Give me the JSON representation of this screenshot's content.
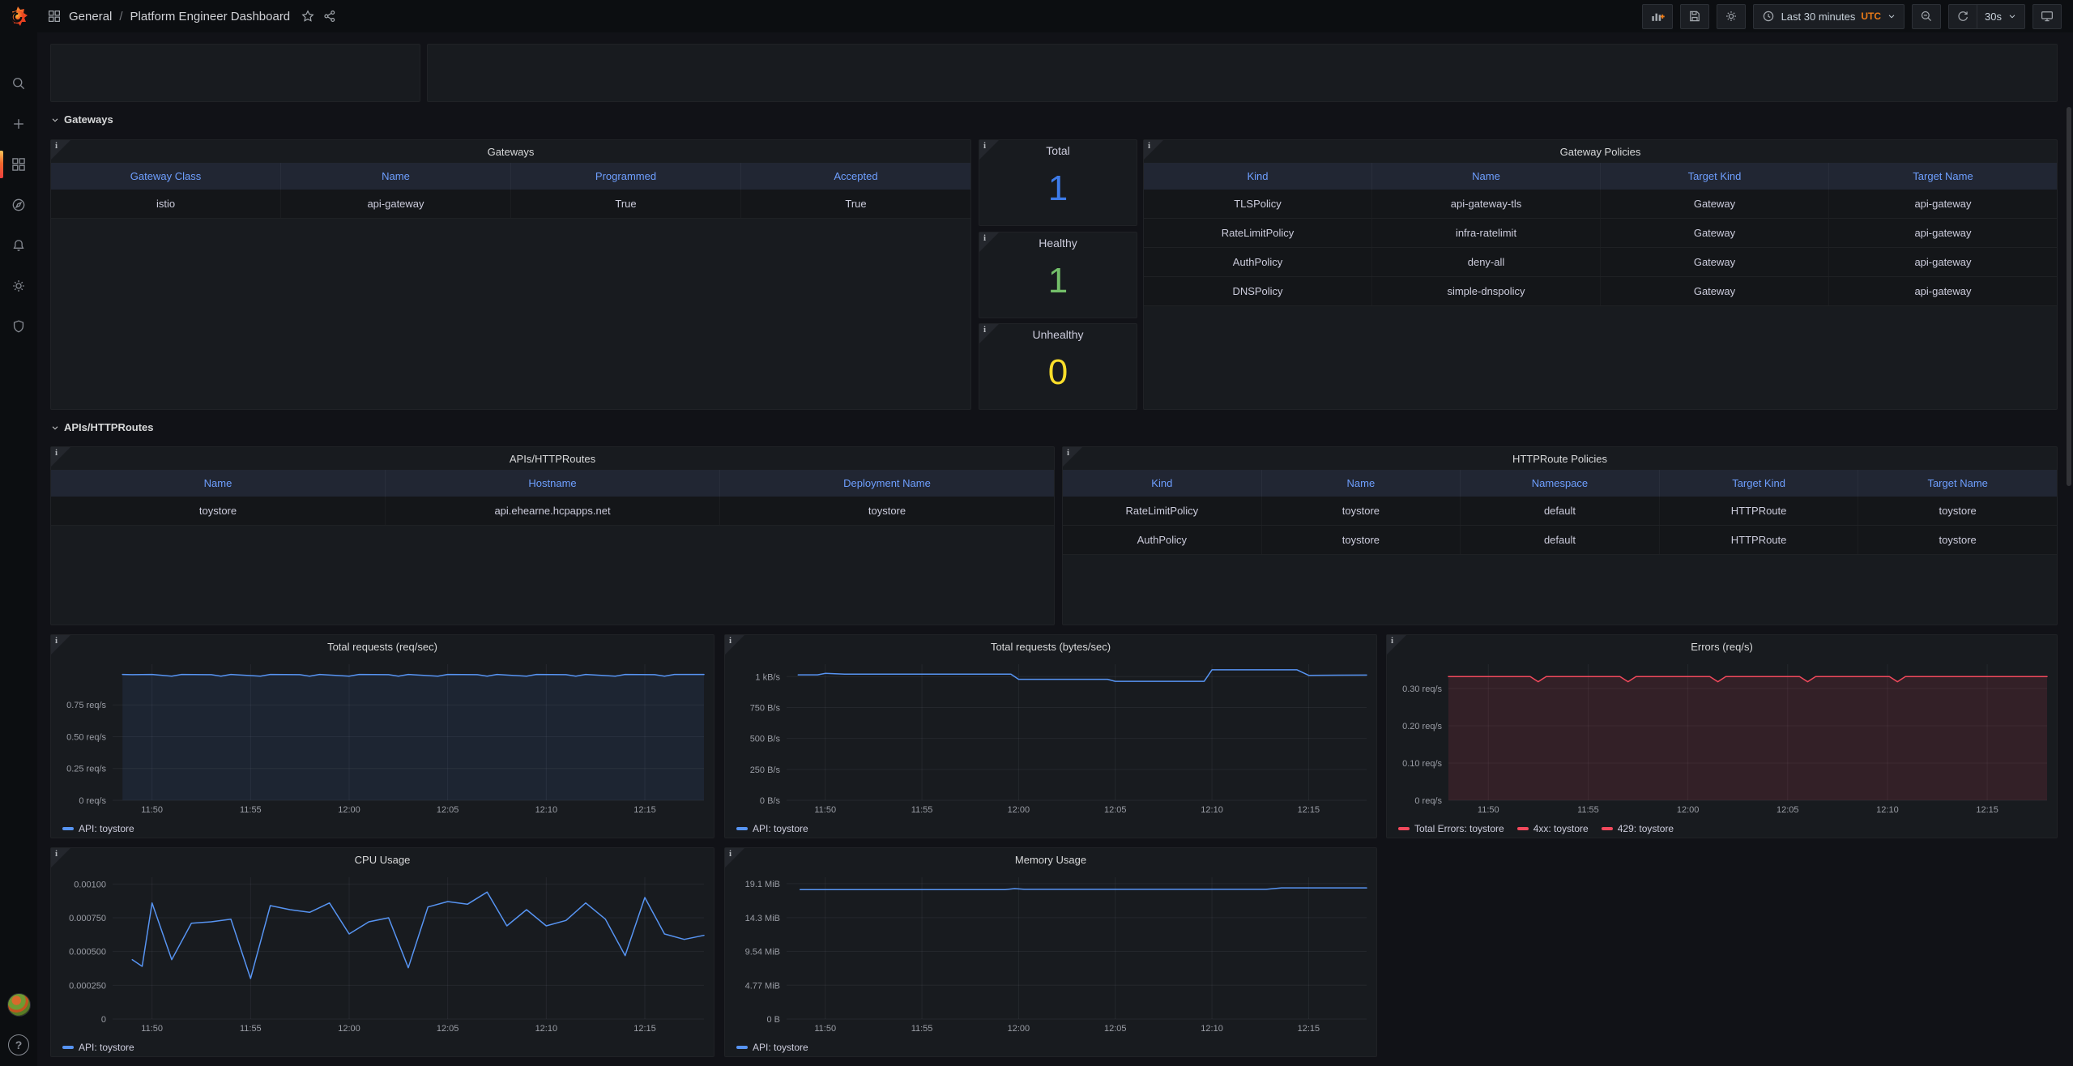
{
  "header": {
    "breadcrumb": {
      "folder": "General",
      "separator": "/",
      "title": "Platform Engineer Dashboard"
    },
    "time_picker": {
      "range_label": "Last 30 minutes",
      "timezone": "UTC"
    },
    "refresh": {
      "interval": "30s"
    },
    "toolbar_icons": [
      "add-panel-icon",
      "save-dashboard-icon",
      "dashboard-settings-icon",
      "clock-icon",
      "zoom-out-icon",
      "refresh-icon",
      "tv-mode-icon",
      "star-icon",
      "share-icon",
      "apps-grid-icon"
    ]
  },
  "sidebar": {
    "items": [
      {
        "icon": "search-icon",
        "active": false
      },
      {
        "icon": "plus-icon",
        "active": false
      },
      {
        "icon": "dashboards-icon",
        "active": true
      },
      {
        "icon": "compass-icon",
        "active": false
      },
      {
        "icon": "bell-icon",
        "active": false
      },
      {
        "icon": "gear-icon",
        "active": false
      },
      {
        "icon": "shield-icon",
        "active": false
      }
    ],
    "bottom": [
      {
        "icon": "avatar"
      },
      {
        "icon": "help-icon",
        "glyph": "?"
      }
    ]
  },
  "sections": [
    {
      "label": "Gateways"
    },
    {
      "label": "APIs/HTTPRoutes"
    }
  ],
  "stats": [
    {
      "title": "Total",
      "value": "1",
      "color": "#3D7BE8"
    },
    {
      "title": "Healthy",
      "value": "1",
      "color": "#73BF69"
    },
    {
      "title": "Unhealthy",
      "value": "0",
      "color": "#FADE2A"
    }
  ],
  "tables": [
    {
      "title": "Gateways",
      "columns": [
        "Gateway Class",
        "Name",
        "Programmed",
        "Accepted"
      ],
      "rows": [
        [
          "istio",
          "api-gateway",
          "True",
          "True"
        ]
      ]
    },
    {
      "title": "Gateway Policies",
      "columns": [
        "Kind",
        "Name",
        "Target Kind",
        "Target Name"
      ],
      "rows": [
        [
          "TLSPolicy",
          "api-gateway-tls",
          "Gateway",
          "api-gateway"
        ],
        [
          "RateLimitPolicy",
          "infra-ratelimit",
          "Gateway",
          "api-gateway"
        ],
        [
          "AuthPolicy",
          "deny-all",
          "Gateway",
          "api-gateway"
        ],
        [
          "DNSPolicy",
          "simple-dnspolicy",
          "Gateway",
          "api-gateway"
        ]
      ]
    },
    {
      "title": "APIs/HTTPRoutes",
      "columns": [
        "Name",
        "Hostname",
        "Deployment Name"
      ],
      "rows": [
        [
          "toystore",
          "api.ehearne.hcpapps.net",
          "toystore"
        ]
      ]
    },
    {
      "title": "HTTPRoute Policies",
      "columns": [
        "Kind",
        "Name",
        "Namespace",
        "Target Kind",
        "Target Name"
      ],
      "rows": [
        [
          "RateLimitPolicy",
          "toystore",
          "default",
          "HTTPRoute",
          "toystore"
        ],
        [
          "AuthPolicy",
          "toystore",
          "default",
          "HTTPRoute",
          "toystore"
        ]
      ]
    }
  ],
  "charts": [
    {
      "title": "Total requests (req/sec)",
      "type": "line",
      "xlim": [
        0,
        30
      ],
      "ylim": [
        0,
        1.07
      ],
      "x_ticks": [
        {
          "v": 2,
          "label": "11:50"
        },
        {
          "v": 7,
          "label": "11:55"
        },
        {
          "v": 12,
          "label": "12:00"
        },
        {
          "v": 17,
          "label": "12:05"
        },
        {
          "v": 22,
          "label": "12:10"
        },
        {
          "v": 27,
          "label": "12:15"
        }
      ],
      "y_ticks": [
        {
          "v": 0,
          "label": "0 req/s"
        },
        {
          "v": 0.25,
          "label": "0.25 req/s"
        },
        {
          "v": 0.5,
          "label": "0.50 req/s"
        },
        {
          "v": 0.75,
          "label": "0.75 req/s"
        }
      ],
      "series": [
        {
          "name": "API: toystore",
          "color": "#5794F2",
          "fill": "rgba(87,148,242,0.09)",
          "points": [
            [
              0.5,
              0.99
            ],
            [
              1,
              0.988
            ],
            [
              2,
              0.99
            ],
            [
              3,
              0.976
            ],
            [
              3.5,
              0.99
            ],
            [
              5,
              0.988
            ],
            [
              5.5,
              0.976
            ],
            [
              6,
              0.99
            ],
            [
              7.5,
              0.976
            ],
            [
              8,
              0.99
            ],
            [
              9.5,
              0.988
            ],
            [
              10,
              0.976
            ],
            [
              10.5,
              0.99
            ],
            [
              12,
              0.976
            ],
            [
              12.5,
              0.99
            ],
            [
              14,
              0.988
            ],
            [
              14.5,
              0.976
            ],
            [
              15,
              0.99
            ],
            [
              16.5,
              0.976
            ],
            [
              17,
              0.99
            ],
            [
              18.5,
              0.988
            ],
            [
              19,
              0.976
            ],
            [
              19.5,
              0.99
            ],
            [
              21,
              0.976
            ],
            [
              21.5,
              0.99
            ],
            [
              23,
              0.988
            ],
            [
              23.5,
              0.976
            ],
            [
              24,
              0.99
            ],
            [
              25.5,
              0.976
            ],
            [
              26,
              0.99
            ],
            [
              27.5,
              0.988
            ],
            [
              28,
              0.976
            ],
            [
              28.5,
              0.99
            ],
            [
              30,
              0.99
            ]
          ]
        }
      ],
      "legend": [
        {
          "label": "API: toystore",
          "color": "#5794F2"
        }
      ]
    },
    {
      "title": "Total requests (bytes/sec)",
      "type": "line",
      "xlim": [
        0,
        30
      ],
      "ylim": [
        0,
        1100
      ],
      "x_ticks": [
        {
          "v": 2,
          "label": "11:50"
        },
        {
          "v": 7,
          "label": "11:55"
        },
        {
          "v": 12,
          "label": "12:00"
        },
        {
          "v": 17,
          "label": "12:05"
        },
        {
          "v": 22,
          "label": "12:10"
        },
        {
          "v": 27,
          "label": "12:15"
        }
      ],
      "y_ticks": [
        {
          "v": 0,
          "label": "0 B/s"
        },
        {
          "v": 250,
          "label": "250 B/s"
        },
        {
          "v": 500,
          "label": "500 B/s"
        },
        {
          "v": 750,
          "label": "750 B/s"
        },
        {
          "v": 1000,
          "label": "1 kB/s"
        }
      ],
      "series": [
        {
          "name": "API: toystore",
          "color": "#5794F2",
          "fill": null,
          "points": [
            [
              0.6,
              1014
            ],
            [
              1.6,
              1014
            ],
            [
              2,
              1026
            ],
            [
              3,
              1020
            ],
            [
              11.6,
              1020
            ],
            [
              12,
              978
            ],
            [
              16.6,
              978
            ],
            [
              17,
              962
            ],
            [
              21.6,
              962
            ],
            [
              22,
              1055
            ],
            [
              26.4,
              1055
            ],
            [
              27,
              1010
            ],
            [
              30,
              1012
            ]
          ]
        }
      ],
      "legend": [
        {
          "label": "API: toystore",
          "color": "#5794F2"
        }
      ]
    },
    {
      "title": "Errors (req/s)",
      "type": "line",
      "xlim": [
        0,
        30
      ],
      "ylim": [
        0,
        0.365
      ],
      "x_ticks": [
        {
          "v": 2,
          "label": "11:50"
        },
        {
          "v": 7,
          "label": "11:55"
        },
        {
          "v": 12,
          "label": "12:00"
        },
        {
          "v": 17,
          "label": "12:05"
        },
        {
          "v": 22,
          "label": "12:10"
        },
        {
          "v": 27,
          "label": "12:15"
        }
      ],
      "y_ticks": [
        {
          "v": 0,
          "label": "0 req/s"
        },
        {
          "v": 0.1,
          "label": "0.10 req/s"
        },
        {
          "v": 0.2,
          "label": "0.20 req/s"
        },
        {
          "v": 0.3,
          "label": "0.30 req/s"
        }
      ],
      "series": [
        {
          "name": "Total Errors: toystore",
          "color": "#F2495C",
          "fill": "rgba(242,73,92,0.13)",
          "points": [
            [
              0,
              0.332
            ],
            [
              4.1,
              0.332
            ],
            [
              4.5,
              0.318
            ],
            [
              4.9,
              0.332
            ],
            [
              8.6,
              0.332
            ],
            [
              9,
              0.318
            ],
            [
              9.4,
              0.332
            ],
            [
              13.1,
              0.332
            ],
            [
              13.5,
              0.318
            ],
            [
              13.9,
              0.332
            ],
            [
              17.6,
              0.332
            ],
            [
              18,
              0.318
            ],
            [
              18.4,
              0.332
            ],
            [
              22.1,
              0.332
            ],
            [
              22.5,
              0.318
            ],
            [
              22.9,
              0.332
            ],
            [
              30,
              0.332
            ]
          ]
        }
      ],
      "legend": [
        {
          "label": "Total Errors: toystore",
          "color": "#F2495C"
        },
        {
          "label": "4xx: toystore",
          "color": "#F2495C"
        },
        {
          "label": "429: toystore",
          "color": "#F2495C"
        }
      ]
    },
    {
      "title": "CPU Usage",
      "type": "line",
      "xlim": [
        0,
        30
      ],
      "ylim": [
        0,
        0.00105
      ],
      "x_ticks": [
        {
          "v": 2,
          "label": "11:50"
        },
        {
          "v": 7,
          "label": "11:55"
        },
        {
          "v": 12,
          "label": "12:00"
        },
        {
          "v": 17,
          "label": "12:05"
        },
        {
          "v": 22,
          "label": "12:10"
        },
        {
          "v": 27,
          "label": "12:15"
        }
      ],
      "y_ticks": [
        {
          "v": 0,
          "label": "0"
        },
        {
          "v": 0.00025,
          "label": "0.000250"
        },
        {
          "v": 0.0005,
          "label": "0.000500"
        },
        {
          "v": 0.00075,
          "label": "0.000750"
        },
        {
          "v": 0.001,
          "label": "0.00100"
        }
      ],
      "series": [
        {
          "name": "API: toystore",
          "color": "#5794F2",
          "fill": null,
          "points": [
            [
              1,
              0.00044
            ],
            [
              1.5,
              0.00039
            ],
            [
              2,
              0.00086
            ],
            [
              3,
              0.00044
            ],
            [
              4,
              0.00071
            ],
            [
              5,
              0.00072
            ],
            [
              6,
              0.00074
            ],
            [
              7,
              0.0003
            ],
            [
              8,
              0.00084
            ],
            [
              9,
              0.00081
            ],
            [
              10,
              0.00079
            ],
            [
              11,
              0.00086
            ],
            [
              12,
              0.00063
            ],
            [
              13,
              0.00072
            ],
            [
              14,
              0.00075
            ],
            [
              15,
              0.00038
            ],
            [
              16,
              0.00083
            ],
            [
              17,
              0.00087
            ],
            [
              18,
              0.00085
            ],
            [
              19,
              0.00094
            ],
            [
              20,
              0.00069
            ],
            [
              21,
              0.00081
            ],
            [
              22,
              0.00069
            ],
            [
              23,
              0.00073
            ],
            [
              24,
              0.00086
            ],
            [
              25,
              0.00074
            ],
            [
              26,
              0.00047
            ],
            [
              27,
              0.0009
            ],
            [
              28,
              0.00063
            ],
            [
              29,
              0.00059
            ],
            [
              30,
              0.00062
            ]
          ]
        }
      ],
      "legend": [
        {
          "label": "API: toystore",
          "color": "#5794F2"
        }
      ]
    },
    {
      "title": "Memory Usage",
      "type": "line",
      "xlim": [
        0,
        30
      ],
      "ylim": [
        0,
        20
      ],
      "x_ticks": [
        {
          "v": 2,
          "label": "11:50"
        },
        {
          "v": 7,
          "label": "11:55"
        },
        {
          "v": 12,
          "label": "12:00"
        },
        {
          "v": 17,
          "label": "12:05"
        },
        {
          "v": 22,
          "label": "12:10"
        },
        {
          "v": 27,
          "label": "12:15"
        }
      ],
      "y_ticks": [
        {
          "v": 0,
          "label": "0 B"
        },
        {
          "v": 4.77,
          "label": "4.77 MiB"
        },
        {
          "v": 9.54,
          "label": "9.54 MiB"
        },
        {
          "v": 14.3,
          "label": "14.3 MiB"
        },
        {
          "v": 19.1,
          "label": "19.1 MiB"
        }
      ],
      "series": [
        {
          "name": "API: toystore",
          "color": "#5794F2",
          "fill": null,
          "points": [
            [
              0.7,
              18.25
            ],
            [
              11.3,
              18.25
            ],
            [
              11.8,
              18.4
            ],
            [
              12.3,
              18.3
            ],
            [
              24.8,
              18.3
            ],
            [
              25.6,
              18.5
            ],
            [
              30,
              18.5
            ]
          ]
        }
      ],
      "legend": [
        {
          "label": "API: toystore",
          "color": "#5794F2"
        }
      ]
    }
  ],
  "colors": {
    "accent_orange": "#eb7b18",
    "link_blue": "#6e9fff",
    "series_blue": "#5794F2",
    "series_red": "#F2495C",
    "stat_blue": "#3D7BE8",
    "stat_green": "#73BF69",
    "stat_yellow": "#FADE2A"
  }
}
